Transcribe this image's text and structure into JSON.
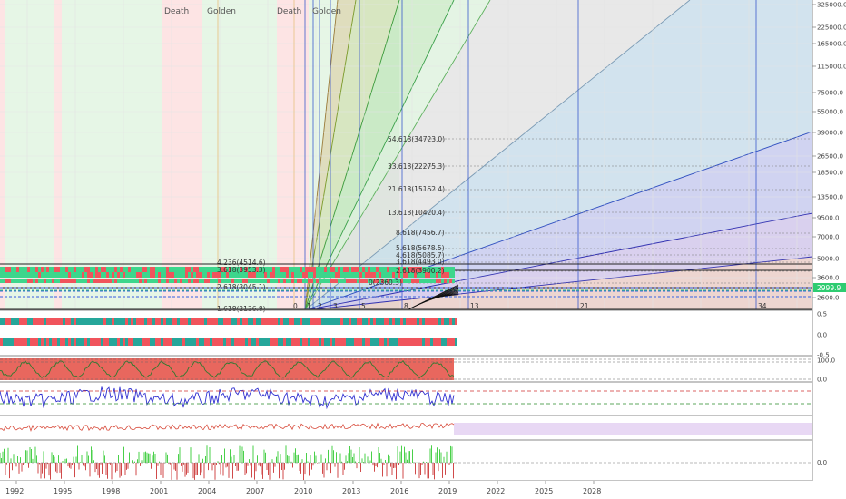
{
  "chart_data": {
    "type": "line",
    "title": "",
    "price_scale": "log",
    "x_axis": {
      "tick_labels": [
        "1992",
        "1995",
        "1998",
        "2001",
        "2004",
        "2007",
        "2010",
        "2013",
        "2016",
        "2019",
        "2022",
        "2025",
        "2028"
      ]
    },
    "y_axis_main": {
      "tick_labels": [
        "325000.0",
        "225000.0",
        "165000.0",
        "115000.0",
        "75000.0",
        "55000.0",
        "39000.0",
        "26500.0",
        "18500.0",
        "13500.0",
        "9500.0",
        "7000.0",
        "5000.0",
        "3600.0",
        "2600.0"
      ],
      "last_price": "2999.9"
    },
    "cross_labels": [
      "Death",
      "Golden",
      "Death",
      "Golden"
    ],
    "fib_extension_labels": [
      "54.618(34723.0)",
      "33.618(22275.3)",
      "21.618(15162.4)",
      "13.618(10420.4)",
      "8.618(7456.7)",
      "5.618(5678.5)",
      "4.618(5085.7)",
      "3.618(4493.0)",
      "2.618(3900.2)",
      "0(2360.3)",
      "4.236(4514.6)",
      "3.618(3953.3)",
      "2.618(3045.1)",
      "1.618(2136.8)"
    ],
    "fib_time_labels": [
      "0",
      "1",
      "2",
      "3",
      "5",
      "8",
      "13",
      "21",
      "34"
    ],
    "oscillator_1": {
      "tick_labels": [
        "0.5",
        "0.0",
        "-0.5"
      ]
    },
    "oscillator_2": {
      "tick_labels": [
        "100.0",
        "0.0"
      ]
    },
    "oscillator_3": {
      "tick_labels": [
        "0.0"
      ]
    },
    "grid": true
  },
  "colors": {
    "bull": "#3dd68c",
    "bear": "#f0545c",
    "teal": "#26a69a",
    "blue_line": "#3030d0",
    "price_tag": "#2ecc71",
    "pane_red": "#c0392b",
    "pane_green": "#7ee07e"
  }
}
